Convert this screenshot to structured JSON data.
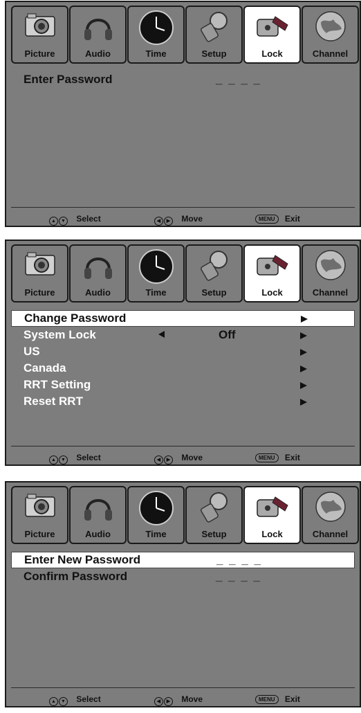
{
  "tabs": [
    {
      "label": "Picture",
      "icon": "camera-icon"
    },
    {
      "label": "Audio",
      "icon": "headphones-icon"
    },
    {
      "label": "Time",
      "icon": "clock-icon"
    },
    {
      "label": "Setup",
      "icon": "setup-icon"
    },
    {
      "label": "Lock",
      "icon": "lock-icon",
      "active": true
    },
    {
      "label": "Channel",
      "icon": "globe-icon"
    }
  ],
  "footer": {
    "select_label": "Select",
    "move_label": "Move",
    "menu_key": "MENU",
    "exit_label": "Exit",
    "up_down_glyphs": [
      "▲",
      "▼"
    ],
    "left_right_glyphs": [
      "◀",
      "▶"
    ]
  },
  "screen1": {
    "enter_password_label": "Enter Password",
    "password_value": "_ _ _ _"
  },
  "screen2": {
    "items": [
      {
        "label": "Change Password"
      },
      {
        "label": "System Lock",
        "value": "Off"
      },
      {
        "label": "US"
      },
      {
        "label": "Canada"
      },
      {
        "label": "RRT Setting"
      },
      {
        "label": "Reset RRT"
      }
    ]
  },
  "screen3": {
    "new_password_label": "Enter New Password",
    "new_password_value": "_ _ _ _",
    "confirm_password_label": "Confirm Password",
    "confirm_password_value": "_ _ _ _"
  },
  "colors": {
    "panel_bg": "#7d7d7d",
    "selected_row_bg": "#ffffff",
    "text_light": "#ffffff",
    "text_dark": "#111111"
  }
}
